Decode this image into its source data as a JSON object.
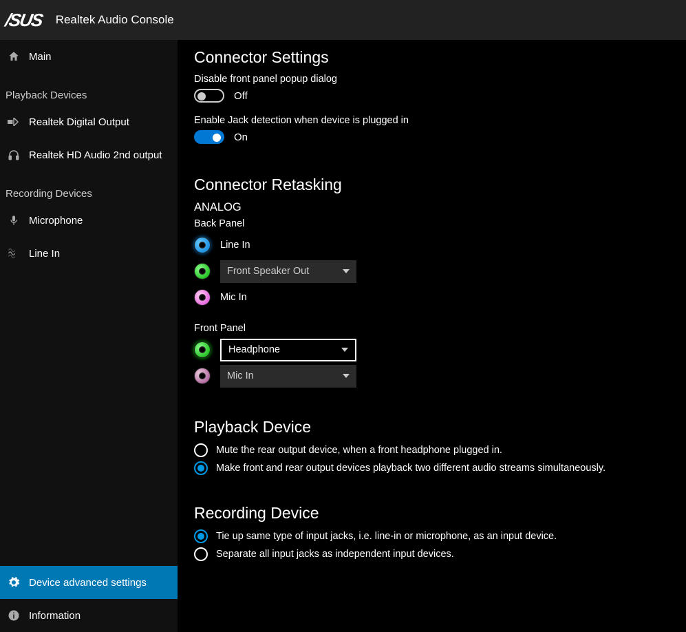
{
  "app": {
    "logo": "/SUS",
    "title": "Realtek Audio Console"
  },
  "sidebar": {
    "main": "Main",
    "playback_header": "Playback Devices",
    "playback": [
      "Realtek Digital Output",
      "Realtek HD Audio 2nd output"
    ],
    "recording_header": "Recording Devices",
    "recording": [
      "Microphone",
      "Line In"
    ],
    "advanced": "Device advanced settings",
    "info": "Information"
  },
  "content": {
    "connector_settings": "Connector Settings",
    "disable_popup_label": "Disable front panel popup dialog",
    "disable_popup_state": "Off",
    "enable_jack_label": "Enable Jack detection when device is plugged in",
    "enable_jack_state": "On",
    "retasking_title": "Connector Retasking",
    "analog": "ANALOG",
    "back_panel": "Back Panel",
    "back": {
      "linein": "Line In",
      "front_speaker": "Front Speaker Out",
      "micin": "Mic In"
    },
    "front_panel": "Front Panel",
    "front": {
      "headphone": "Headphone",
      "micin": "Mic In"
    },
    "playback_device": "Playback Device",
    "playback_opt1": "Mute the rear output device, when a front headphone plugged in.",
    "playback_opt2": "Make front and rear output devices playback two different audio streams simultaneously.",
    "recording_device": "Recording Device",
    "recording_opt1": "Tie up same type of input jacks, i.e. line-in or microphone, as an input device.",
    "recording_opt2": "Separate all input jacks as independent input devices."
  }
}
